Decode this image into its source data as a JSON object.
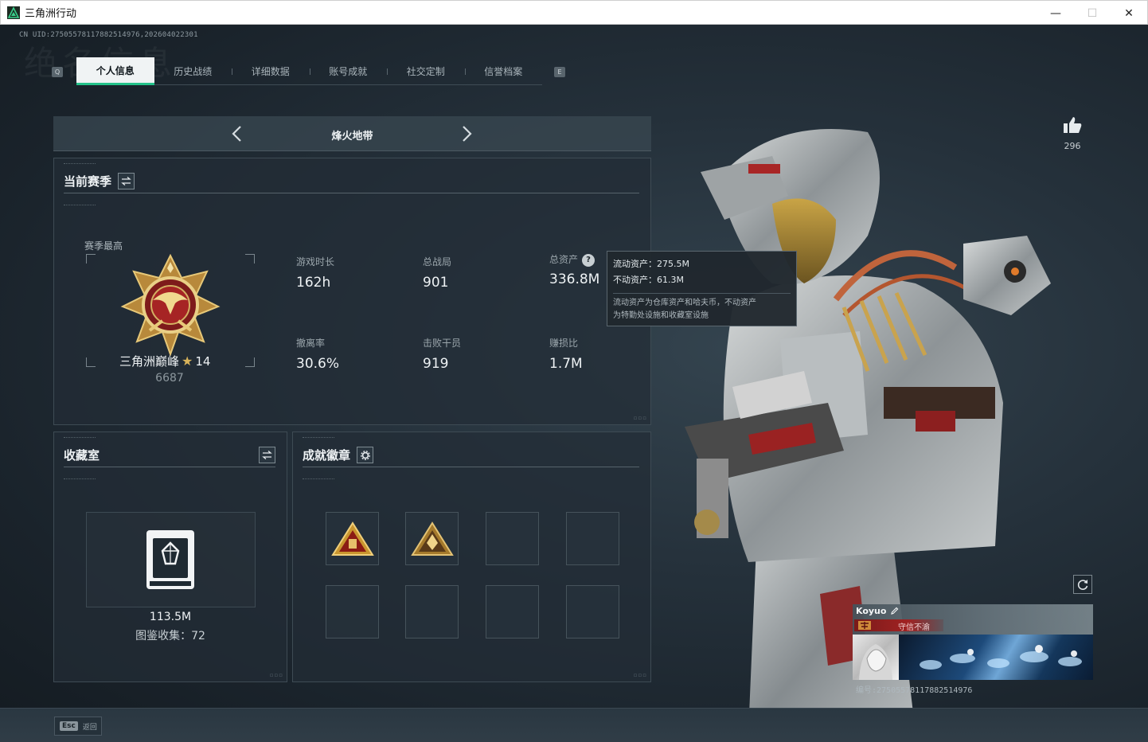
{
  "window": {
    "title": "三角洲行动",
    "minimize": "—",
    "maximize": "☐",
    "close": "✕"
  },
  "header": {
    "uid_line": "CN UID:2750557811788251497​6,202604022301",
    "watermark": "绝名信息"
  },
  "tabs": {
    "left_hint": "Q",
    "right_hint": "E",
    "items": [
      {
        "label": "个人信息",
        "active": true
      },
      {
        "label": "历史战绩",
        "active": false
      },
      {
        "label": "详细数据",
        "active": false
      },
      {
        "label": "账号成就",
        "active": false
      },
      {
        "label": "社交定制",
        "active": false
      },
      {
        "label": "信誉档案",
        "active": false
      }
    ]
  },
  "mode": {
    "title": "烽火地带",
    "prev": "‹",
    "next": "›"
  },
  "season": {
    "title": "当前赛季",
    "best_label": "赛季最高",
    "rank_name": "三角洲巅峰",
    "rank_stars": "14",
    "rank_score": "6687",
    "stats": [
      {
        "label": "游戏时长",
        "value": "162h"
      },
      {
        "label": "总战局",
        "value": "901"
      },
      {
        "label": "总资产",
        "value": "336.8M",
        "help": "?"
      },
      {
        "label": "撤离率",
        "value": "30.6%"
      },
      {
        "label": "击败干员",
        "value": "919"
      },
      {
        "label": "赚损比",
        "value": "1.7M"
      }
    ]
  },
  "tooltip": {
    "liquid": "流动资产：275.5M",
    "fixed": "不动资产：61.3M",
    "desc_line1": "流动资产为仓库资产和哈夫币，不动资产",
    "desc_line2": "为特勤处设施和收藏室设施"
  },
  "collection": {
    "title": "收藏室",
    "value": "113.5M",
    "sub": "图鉴收集：72"
  },
  "badges": {
    "title": "成就徽章",
    "slots_filled": 2,
    "slots_total": 8
  },
  "right": {
    "likes": "296"
  },
  "namecard": {
    "name": "Koyuo",
    "title": "守信不渝",
    "id": "编号:2750557811788251497​6"
  },
  "footer": {
    "esc_key": "Esc",
    "esc_label": "返回"
  },
  "colors": {
    "accent": "#24c28a",
    "gold": "#d9b45a",
    "title_red": "#a02222"
  }
}
